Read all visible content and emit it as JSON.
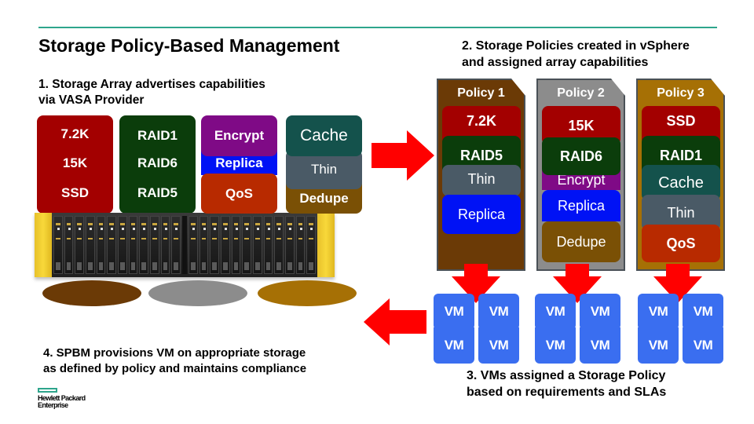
{
  "title": "Storage Policy-Based Management",
  "colors": {
    "accent_rule": "#2ea58c",
    "speed": "#a30000",
    "raid": "#0b3d0b",
    "encrypt": "#7f0a86",
    "replica": "#0012f5",
    "qos": "#b82a00",
    "cache": "#14524c",
    "thin": "#4a5a66",
    "dedupe": "#7a5005",
    "arrow": "#ff0000",
    "vm": "#3a6ef0",
    "pool1": "#6b3a06",
    "pool2": "#8c8c8c",
    "pool3": "#a67005"
  },
  "steps": {
    "step1": [
      "1. Storage Array advertises capabilities",
      "via VASA Provider"
    ],
    "step2": [
      "2. Storage Policies created in vSphere",
      "and assigned array capabilities"
    ],
    "step3": [
      "3. VMs assigned a Storage Policy",
      "based on requirements and SLAs"
    ],
    "step4": [
      "4. SPBM provisions VM on appropriate storage",
      "as defined by policy and maintains compliance"
    ]
  },
  "array_capabilities": {
    "disk_speed": [
      "7.2K",
      "15K",
      "SSD"
    ],
    "raid_level": [
      "RAID1",
      "RAID6",
      "RAID5"
    ],
    "data_services": [
      "Encrypt",
      "Replica",
      "QoS"
    ],
    "efficiency": [
      "Cache",
      "Thin",
      "Dedupe"
    ]
  },
  "storage_pools": [
    "pool-1",
    "pool-2",
    "pool-3"
  ],
  "policies": [
    {
      "name": "Policy 1",
      "capabilities": [
        "7.2K",
        "RAID5",
        "Thin",
        "Replica"
      ]
    },
    {
      "name": "Policy 2",
      "capabilities": [
        "15K",
        "RAID6",
        "Encrypt",
        "Replica",
        "Dedupe"
      ]
    },
    {
      "name": "Policy 3",
      "capabilities": [
        "SSD",
        "RAID1",
        "Cache",
        "Thin",
        "QoS"
      ]
    }
  ],
  "vm_label": "VM",
  "vm_groups": [
    [
      "VM",
      "VM",
      "VM",
      "VM"
    ],
    [
      "VM",
      "VM",
      "VM",
      "VM"
    ],
    [
      "VM",
      "VM",
      "VM",
      "VM"
    ]
  ],
  "logo": {
    "line1": "Hewlett Packard",
    "line2": "Enterprise"
  }
}
